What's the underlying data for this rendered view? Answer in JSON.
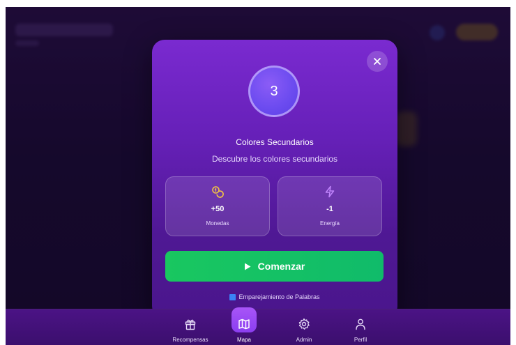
{
  "modal": {
    "close_symbol": "×",
    "level_number": "3",
    "title": "Colores Secundarios",
    "description": "Descubre los colores secundarios",
    "rewards": [
      {
        "icon": "coins-icon",
        "value": "+50",
        "label": "Monedas"
      },
      {
        "icon": "lightning-icon",
        "value": "-1",
        "label": "Energía"
      }
    ],
    "start_label": "Comenzar",
    "game_type_label": "Emparejamiento de Palabras"
  },
  "nav": {
    "items": [
      {
        "label": "Recompensas",
        "icon": "gift-icon"
      },
      {
        "label": "Mapa",
        "icon": "map-icon",
        "active": true
      },
      {
        "label": "Admin",
        "icon": "gear-icon"
      },
      {
        "label": "Perfil",
        "icon": "user-icon"
      }
    ]
  },
  "colors": {
    "modal_top": "#7a2ad0",
    "start_button": "#19c760",
    "coins": "#f5c542",
    "energy": "#c084fc",
    "nav_active": "#a855f7"
  }
}
